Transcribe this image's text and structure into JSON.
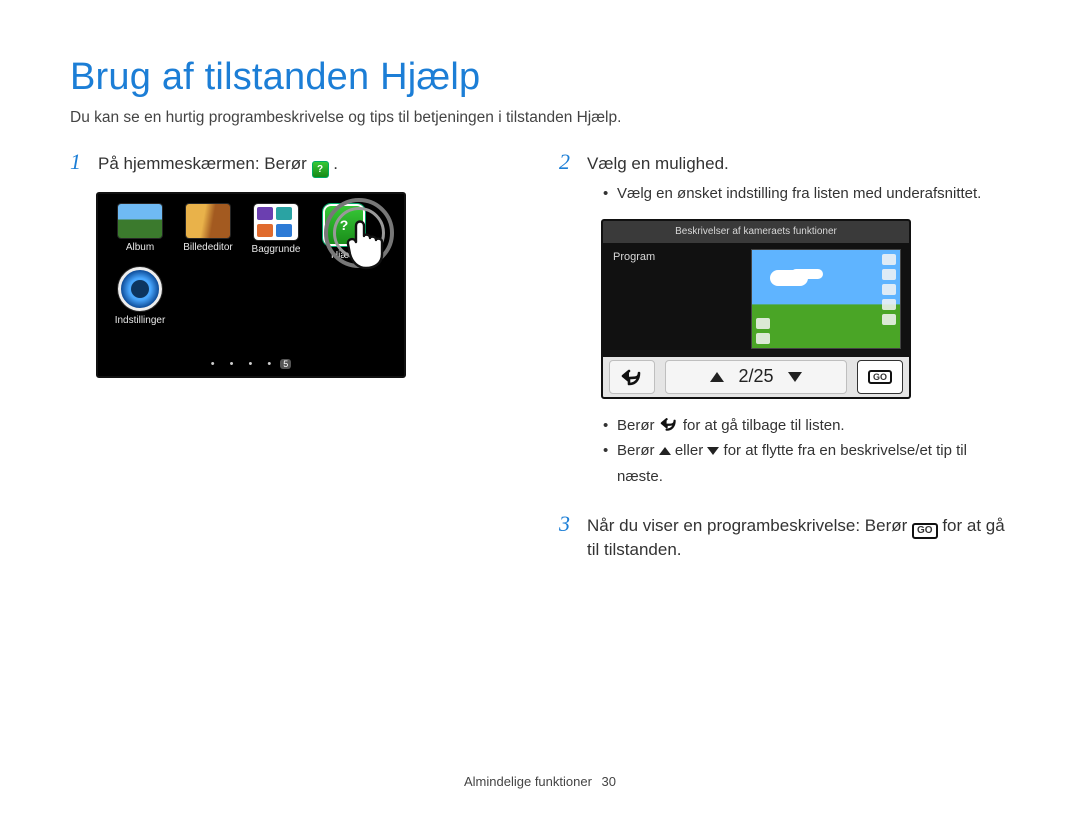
{
  "title": "Brug af tilstanden Hjælp",
  "subtitle": "Du kan se en hurtig programbeskrivelse og tips til betjeningen i tilstanden Hjælp.",
  "step1": {
    "num": "1",
    "pre": "På hjemmeskærmen: Berør ",
    "post": "."
  },
  "step2": {
    "num": "2",
    "text": "Vælg en mulighed."
  },
  "step2_sub": "Vælg en ønsket indstilling fra listen med underafsnittet.",
  "step3": {
    "num": "3",
    "pre": "Når du viser en programbeskrivelse: Berør ",
    "post": " for at gå til tilstanden."
  },
  "home": {
    "items": [
      "Album",
      "Billededitor",
      "Baggrunde",
      "Hjælp",
      "Indstillinger"
    ]
  },
  "cam": {
    "topbar": "Beskrivelser af kameraets funktioner",
    "mode": "Program",
    "counter": "2/25",
    "go": "GO"
  },
  "bullets": {
    "b1_pre": "Berør ",
    "b1_post": " for at gå tilbage til listen.",
    "b2_pre": "Berør ",
    "b2_mid": " eller ",
    "b2_post": " for at flytte fra en beskrivelse/et tip til næste."
  },
  "footer": {
    "section": "Almindelige funktioner",
    "page": "30"
  },
  "colors": {
    "bgd_tiles": [
      "#6b3fb0",
      "#2aa3a3",
      "#e06b2e",
      "#2e7bd6"
    ]
  }
}
